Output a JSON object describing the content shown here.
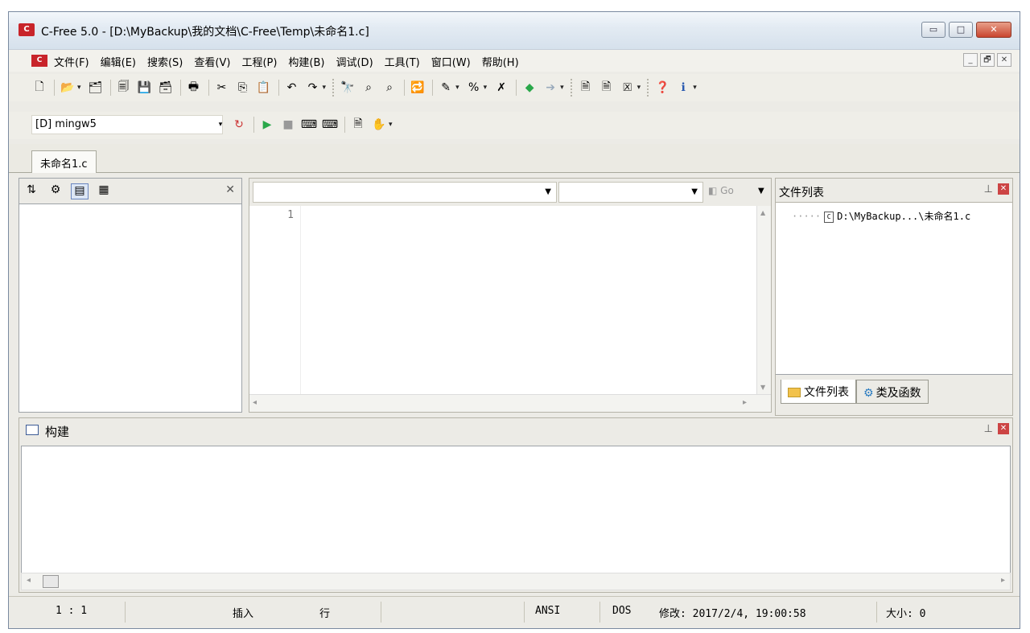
{
  "window": {
    "app_logo": "C",
    "title": "C-Free 5.0 - [D:\\MyBackup\\我的文档\\C-Free\\Temp\\未命名1.c]",
    "minimize": "▭",
    "maximize": "□",
    "close": "✕"
  },
  "menu": {
    "logo": "C",
    "items": [
      "文件(F)",
      "编辑(E)",
      "搜索(S)",
      "查看(V)",
      "工程(P)",
      "构建(B)",
      "调试(D)",
      "工具(T)",
      "窗口(W)",
      "帮助(H)"
    ],
    "mdi_minimize": "_",
    "mdi_restore": "🗗",
    "mdi_close": "✕"
  },
  "toolbar2": {
    "compiler": "[D] mingw5"
  },
  "doc_tabs": [
    "未命名1.c"
  ],
  "editor": {
    "line_numbers": [
      "1"
    ],
    "go_label": "Go"
  },
  "file_panel": {
    "title": "文件列表",
    "tree_item": "D:\\MyBackup...\\未命名1.c",
    "tabs": [
      "文件列表",
      "类及函数"
    ]
  },
  "build_panel": {
    "title": "构建"
  },
  "statusbar": {
    "position": "1 : 1",
    "mode": "插入",
    "unit": "行",
    "encoding": "ANSI",
    "line_ending": "DOS",
    "modified": "修改: 2017/2/4, 19:00:58",
    "size": "大小: 0"
  },
  "colors": {
    "accent": "#c8242a",
    "panel_bg": "#ecebe6",
    "close_red": "#c9452f"
  }
}
